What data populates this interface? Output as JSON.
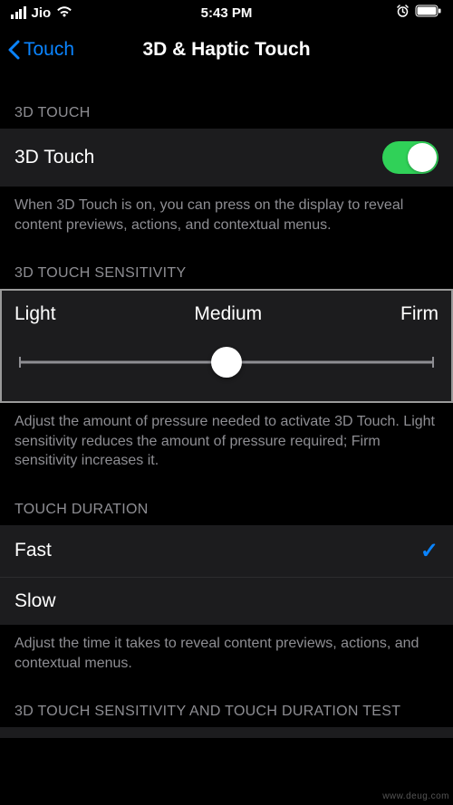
{
  "status": {
    "carrier": "Jio",
    "time": "5:43 PM"
  },
  "nav": {
    "back": "Touch",
    "title": "3D & Haptic Touch"
  },
  "sections": {
    "threeD": {
      "header": "3D TOUCH",
      "row_label": "3D Touch",
      "toggle_on": true,
      "footer": "When 3D Touch is on, you can press on the display to reveal content previews, actions, and contextual menus."
    },
    "sensitivity": {
      "header": "3D TOUCH SENSITIVITY",
      "labels": {
        "light": "Light",
        "medium": "Medium",
        "firm": "Firm"
      },
      "footer": "Adjust the amount of pressure needed to activate 3D Touch. Light sensitivity reduces the amount of pressure required; Firm sensitivity increases it."
    },
    "duration": {
      "header": "TOUCH DURATION",
      "options": {
        "fast": "Fast",
        "slow": "Slow"
      },
      "selected": "fast",
      "footer": "Adjust the time it takes to reveal content previews, actions, and contextual menus."
    },
    "test": {
      "header": "3D TOUCH SENSITIVITY AND TOUCH DURATION TEST"
    }
  },
  "watermark": "www.deug.com"
}
